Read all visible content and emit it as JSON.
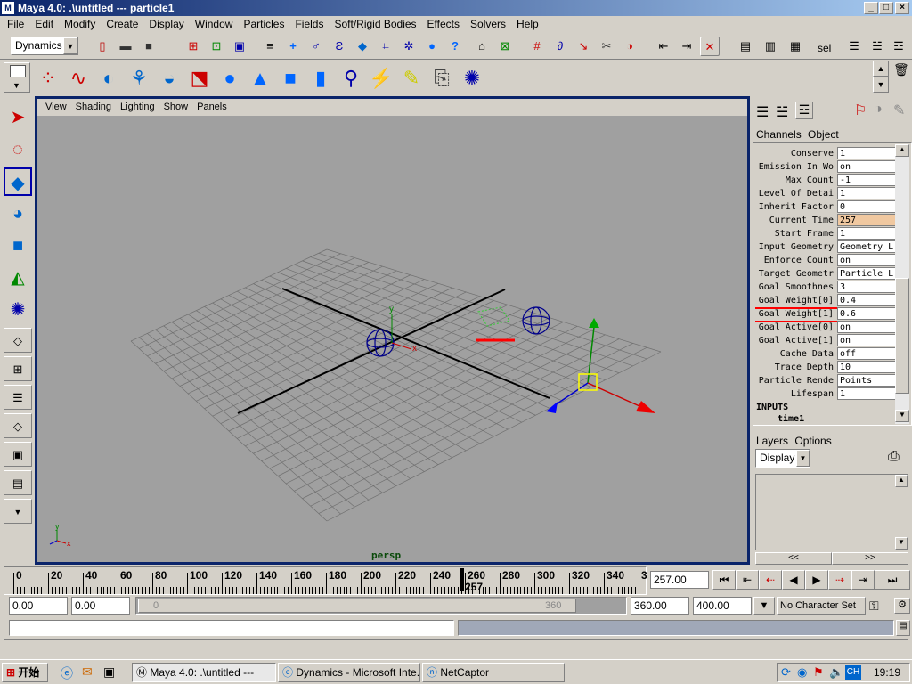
{
  "window": {
    "title": "Maya 4.0: .\\untitled  ---  particle1",
    "app_icon": "maya-icon"
  },
  "menubar": [
    "File",
    "Edit",
    "Modify",
    "Create",
    "Display",
    "Window",
    "Particles",
    "Fields",
    "Soft/Rigid Bodies",
    "Effects",
    "Solvers",
    "Help"
  ],
  "statusline": {
    "menuset": "Dynamics",
    "sel_label": "sel"
  },
  "viewport": {
    "menus": [
      "View",
      "Shading",
      "Lighting",
      "Show",
      "Panels"
    ],
    "camera": "persp",
    "axis_labels": {
      "x": "x",
      "y": "y"
    }
  },
  "channelbox": {
    "tabs": [
      "Channels",
      "Object"
    ],
    "attributes": [
      {
        "label": "Conserve",
        "value": "1"
      },
      {
        "label": "Emission In Wo",
        "value": "on"
      },
      {
        "label": "Max Count",
        "value": "-1"
      },
      {
        "label": "Level Of Detai",
        "value": "1"
      },
      {
        "label": "Inherit Factor",
        "value": "0"
      },
      {
        "label": "Current Time",
        "value": "257"
      },
      {
        "label": "Start Frame",
        "value": "1"
      },
      {
        "label": "Input Geometry",
        "value": "Geometry L"
      },
      {
        "label": "Enforce Count",
        "value": "on"
      },
      {
        "label": "Target Geometr",
        "value": "Particle L"
      },
      {
        "label": "Goal Smoothnes",
        "value": "3"
      },
      {
        "label": "Goal Weight[0]",
        "value": "0.4"
      },
      {
        "label": "Goal Weight[1]",
        "value": "0.6"
      },
      {
        "label": "Goal Active[0]",
        "value": "on"
      },
      {
        "label": "Goal Active[1]",
        "value": "on"
      },
      {
        "label": "Cache Data",
        "value": "off"
      },
      {
        "label": "Trace Depth",
        "value": "10"
      },
      {
        "label": "Particle Rende",
        "value": "Points"
      },
      {
        "label": "Lifespan",
        "value": "1"
      }
    ],
    "inputs_header": "INPUTS",
    "inputs_item": "time1"
  },
  "layers": {
    "tabs": [
      "Layers",
      "Options"
    ],
    "display": "Display",
    "nav": [
      "<<",
      ">>"
    ]
  },
  "timeslider": {
    "ticks": [
      "0",
      "20",
      "40",
      "60",
      "80",
      "100",
      "120",
      "140",
      "160",
      "180",
      "200",
      "220",
      "240",
      "260",
      "280",
      "300",
      "320",
      "340",
      "3"
    ],
    "current_marker": "257",
    "current_time": "257.00"
  },
  "range": {
    "start": "0.00",
    "anim_start": "0.00",
    "slider_start": "0",
    "slider_end": "360",
    "end": "360.00",
    "anim_end": "400.00",
    "character_set": "No Character Set"
  },
  "taskbar": {
    "start": "开始",
    "tasks": [
      "Maya 4.0: .\\untitled  ---",
      "Dynamics - Microsoft Inte...",
      "NetCaptor"
    ],
    "clock": "19:19",
    "ime": "CH"
  },
  "colors": {
    "viewport_border": "#0a246a",
    "highlight": "#f0c8a0",
    "annotation": "#ff0000"
  }
}
